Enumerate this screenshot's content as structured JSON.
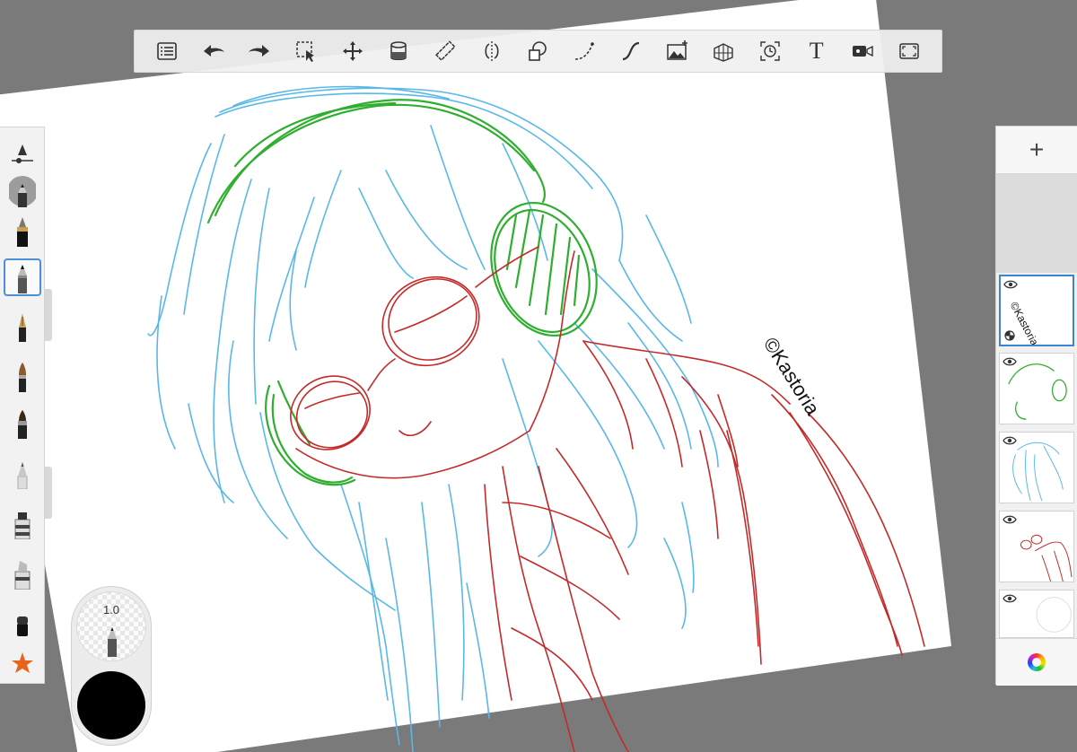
{
  "colors": {
    "background": "#7a7a7a",
    "paper": "#ffffff",
    "hair_stroke": "#5ab8e8",
    "headphone_stroke": "#2fae2f",
    "body_stroke": "#c42a2a",
    "selection_blue": "#3a86d4",
    "current_brush_color": "#000000"
  },
  "canvas": {
    "signature": "©Kastoria"
  },
  "toolbar": {
    "items": [
      {
        "icon": "list-icon"
      },
      {
        "icon": "undo-icon"
      },
      {
        "icon": "redo-icon"
      },
      {
        "icon": "selection-icon"
      },
      {
        "icon": "transform-icon"
      },
      {
        "icon": "fill-icon"
      },
      {
        "icon": "ruler-icon"
      },
      {
        "icon": "symmetry-icon"
      },
      {
        "icon": "shape-icon"
      },
      {
        "icon": "curve-icon"
      },
      {
        "icon": "stroke-icon"
      },
      {
        "icon": "add-image-icon"
      },
      {
        "icon": "perspective-icon"
      },
      {
        "icon": "time-lapse-icon"
      },
      {
        "icon": "text-icon",
        "label": "T"
      },
      {
        "icon": "video-icon"
      },
      {
        "icon": "fullscreen-icon"
      }
    ]
  },
  "brushes": {
    "items": [
      {
        "icon": "brush-settings-icon"
      },
      {
        "icon": "pencil-brush-icon"
      },
      {
        "icon": "ink-brush-icon"
      },
      {
        "icon": "pencil-brush-icon",
        "selected": true
      },
      {
        "icon": "fountain-pen-icon"
      },
      {
        "icon": "paint-brush-icon"
      },
      {
        "icon": "marker-brush-icon"
      },
      {
        "icon": "airbrush-icon"
      },
      {
        "icon": "marker-icon"
      },
      {
        "icon": "wide-marker-icon"
      },
      {
        "icon": "eraser-icon"
      },
      {
        "icon": "favorites-star-icon"
      }
    ]
  },
  "puck": {
    "size_value": "1.0",
    "color": "#000000"
  },
  "layers": {
    "add_label": "+",
    "items": [
      {
        "name": "signature-layer",
        "text": "©Kastoria",
        "selected": true
      },
      {
        "name": "headphone-layer"
      },
      {
        "name": "hair-layer"
      },
      {
        "name": "body-layer"
      },
      {
        "name": "background-layer"
      }
    ]
  }
}
